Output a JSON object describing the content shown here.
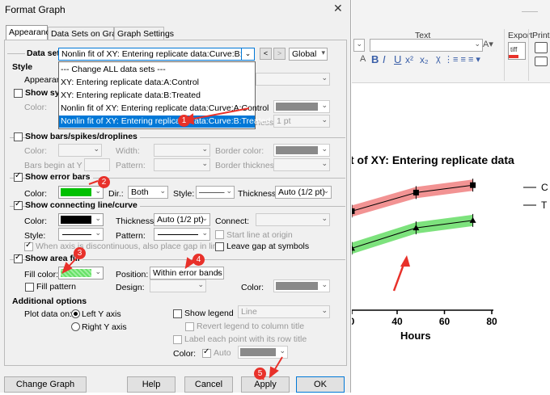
{
  "dialog": {
    "title": "Format Graph",
    "tabs": [
      "Appearance",
      "Data Sets on Graph",
      "Graph Settings"
    ],
    "data_set_label": "Data set:",
    "data_set_value": "Nonlin fit of XY: Entering replicate data:Curve:B:Treated",
    "scope": "Global",
    "dropdown_items": [
      "--- Change ALL data sets ---",
      "XY: Entering replicate data:A:Control",
      "XY: Entering replicate data:B:Treated",
      "Nonlin fit of XY: Entering replicate data:Curve:A:Control",
      "Nonlin fit of XY: Entering replicate data:Curve:B:Treated"
    ],
    "style_header": "Style",
    "appearance_label": "Appearance",
    "show_symbols": "Show sym",
    "color_label": "Color:",
    "thickness_label": "ness:",
    "thickness_sym": "1 pt",
    "bars": {
      "header": "Show bars/spikes/droplines",
      "color": "Color:",
      "width": "Width:",
      "border_color": "Border color:",
      "begin_at": "Bars begin at Y =",
      "pattern": "Pattern:",
      "border_thickness": "Border thickness:"
    },
    "error_bars": {
      "header": "Show error bars",
      "color": "Color:",
      "color_hex": "#00c000",
      "dir_label": "Dir.:",
      "dir_value": "Both",
      "style_label": "Style:",
      "style_value": "———",
      "thickness_label": "Thickness:",
      "thickness_value": "Auto (1/2 pt)"
    },
    "line": {
      "header": "Show connecting line/curve",
      "color": "Color:",
      "color_hex": "#000000",
      "thickness_label": "Thickness:",
      "thickness_value": "Auto (1/2 pt)",
      "connect_label": "Connect:",
      "style_label": "Style:",
      "pattern_label": "Pattern:",
      "start_origin": "Start line at origin",
      "discontinuous": "When axis is discontinuous, also place gap in line",
      "leave_gap": "Leave gap at symbols"
    },
    "area_fill": {
      "header": "Show area fill",
      "fill_color_label": "Fill color:",
      "fill_hex": "#66e066",
      "position_label": "Position:",
      "position_value": "Within error bands",
      "fill_pattern": "Fill pattern",
      "design_label": "Design:",
      "color_label": "Color:"
    },
    "additional": {
      "header": "Additional options",
      "plot_on": "Plot data on:",
      "left_axis": "Left Y axis",
      "right_axis": "Right  Y axis",
      "show_legend": "Show legend",
      "legend_style": "Line",
      "revert_legend": "Revert legend to column title",
      "label_each": "Label each point with its row title",
      "color_label": "Color:",
      "auto_label": "Auto"
    },
    "buttons": {
      "change_type": "Change Graph Type...",
      "help": "Help",
      "cancel": "Cancel",
      "apply": "Apply",
      "ok": "OK"
    },
    "badges": [
      "1",
      "2",
      "3",
      "4",
      "5"
    ]
  },
  "ribbon": {
    "text_group": "Text",
    "export_group": "Export",
    "print_group": "Print",
    "format_buttons": [
      "A",
      "B",
      "I",
      "U",
      "x²",
      "x₂"
    ],
    "tiff_label": "tiff"
  },
  "chart_data": {
    "type": "line",
    "title": "...t of XY: Entering replicate data",
    "xlabel": "Hours",
    "ylabel": "",
    "x_ticks": [
      "0",
      "40",
      "60",
      "80"
    ],
    "xlim": [
      0,
      80
    ],
    "legend": [
      "C",
      "T"
    ],
    "series": [
      {
        "name": "C",
        "x": [
          0,
          48,
          72
        ],
        "values": [
          0.62,
          0.72,
          0.76
        ],
        "marker": "square",
        "band_color": "#f08080"
      },
      {
        "name": "T",
        "x": [
          0,
          48,
          72
        ],
        "values": [
          0.42,
          0.53,
          0.57
        ],
        "marker": "triangle",
        "band_color": "#66dd66"
      }
    ]
  }
}
